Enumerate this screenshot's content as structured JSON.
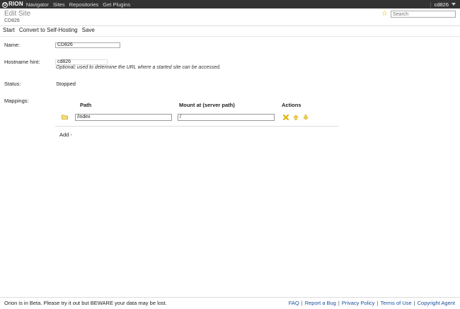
{
  "topbar": {
    "logo_text": "RION",
    "logo_letter": "O",
    "nav": [
      "Navigator",
      "Sites",
      "Repositories",
      "Get Plugins"
    ],
    "user": "cd826"
  },
  "header": {
    "title": "Edit Site",
    "subtitle": "CD826",
    "search_placeholder": "Search"
  },
  "toolbar": {
    "start_label": "Start",
    "convert_label": "Convert to Self-Hosting",
    "save_label": "Save"
  },
  "form": {
    "name_label": "Name:",
    "name_value": "CD826",
    "hostname_label": "Hostname hint:",
    "hostname_value": "cd826",
    "hostname_hint": "Optional; used to determine the URL where a started site can be accessed.",
    "status_label": "Status:",
    "status_value": "Stopped",
    "mappings_label": "Mappings:"
  },
  "mappings": {
    "columns": [
      "Path",
      "Mount at (server path)",
      "Actions"
    ],
    "rows": [
      {
        "path": "/index",
        "mount": "/"
      }
    ],
    "add_label": "Add -"
  },
  "footer": {
    "text": "Orion is in Beta. Please try it out but BEWARE your data may be lost.",
    "links": [
      "FAQ",
      "Report a Bug",
      "Privacy Policy",
      "Terms of Use",
      "Copyright Agent"
    ]
  },
  "colors": {
    "topbar": "#333333",
    "link": "#1a4f9c",
    "star": "#e5a100",
    "folder": "#e8c64a",
    "action_icons": "#e0b000"
  },
  "icons": [
    "star-icon",
    "caret-down-icon",
    "folder-icon",
    "delete-icon",
    "move-up-icon",
    "move-down-icon"
  ]
}
